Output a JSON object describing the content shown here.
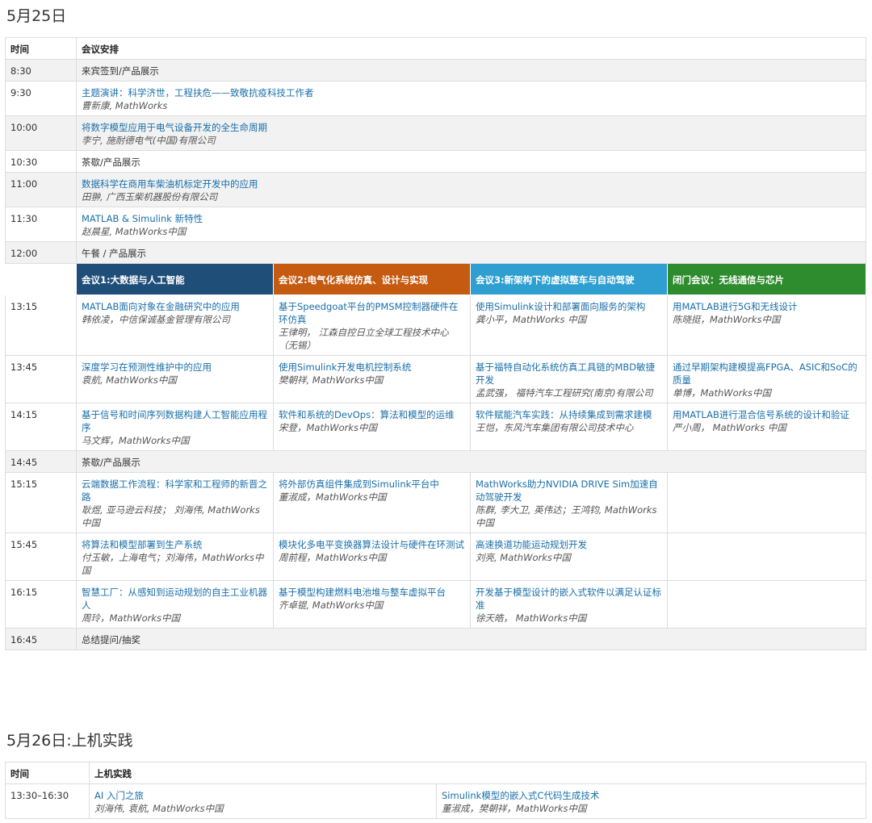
{
  "day1": {
    "heading": "5月25日",
    "header": {
      "time": "时间",
      "agenda": "会议安排"
    },
    "morning": [
      {
        "time": "8:30",
        "type": "plain",
        "text": "来宾签到/产品展示",
        "gray": true
      },
      {
        "time": "9:30",
        "type": "talk",
        "title": "主题演讲：科学济世，工程扶危——致敬抗疫科技工作者",
        "speaker": "曹新康, MathWorks",
        "gray": false
      },
      {
        "time": "10:00",
        "type": "talk",
        "title": "将数字模型应用于电气设备开发的全生命周期",
        "speaker": "李宁, 施耐德电气(中国)有限公司",
        "gray": true
      },
      {
        "time": "10:30",
        "type": "plain",
        "text": "茶歇/产品展示",
        "gray": false
      },
      {
        "time": "11:00",
        "type": "talk",
        "title": "数据科学在商用车柴油机标定开发中的应用",
        "speaker": "田翀, 广西玉柴机器股份有限公司",
        "gray": true
      },
      {
        "time": "11:30",
        "type": "talk",
        "title": "MATLAB & Simulink 新特性",
        "speaker": "赵晨星, MathWorks中国",
        "gray": false
      },
      {
        "time": "12:00",
        "type": "plain",
        "text": "午餐 / 产品展示",
        "gray": true
      }
    ],
    "tracks": [
      {
        "name": "会议1:大数据与人工智能",
        "color": "#1f4e79"
      },
      {
        "name": "会议2:电气化系统仿真、设计与实现",
        "color": "#c55a11"
      },
      {
        "name": "会议3:新架构下的虚拟整车与自动驾驶",
        "color": "#2e9fd0"
      },
      {
        "name": "闭门会议：无线通信与芯片",
        "color": "#2e8b2e"
      }
    ],
    "afternoon": [
      {
        "time": "13:15",
        "sessions": [
          {
            "title": "MATLAB面向对象在金融研究中的应用",
            "speaker": "韩依凌，中信保诚基金管理有限公司"
          },
          {
            "title": "基于Speedgoat平台的PMSM控制器硬件在环仿真",
            "speaker": "王律明， 江森自控日立全球工程技术中心（无锡）"
          },
          {
            "title": "使用Simulink设计和部署面向服务的架构",
            "speaker": "龚小平，MathWorks 中国"
          },
          {
            "title": "用MATLAB进行5G和无线设计",
            "speaker": "陈晓挺，MathWorks中国"
          }
        ]
      },
      {
        "time": "13:45",
        "sessions": [
          {
            "title": "深度学习在预测性维护中的应用",
            "speaker": "袁航, MathWorks中国"
          },
          {
            "title": "使用Simulink开发电机控制系统",
            "speaker": "樊朝祥, MathWorks中国"
          },
          {
            "title": "基于福特自动化系统仿真工具链的MBD敏捷开发",
            "speaker": "孟武强， 福特汽车工程研究(南京)有限公司"
          },
          {
            "title": "通过早期架构建模提高FPGA、ASIC和SoC的质量",
            "speaker": "单博，MathWorks中国"
          }
        ]
      },
      {
        "time": "14:15",
        "sessions": [
          {
            "title": "基于信号和时间序列数据构建人工智能应用程序",
            "speaker": "马文辉，MathWorks中国"
          },
          {
            "title": "软件和系统的DevOps：算法和模型的运维",
            "speaker": "宋登，MathWorks中国"
          },
          {
            "title": "软件赋能汽车实践：从持续集成到需求建模",
            "speaker": "王恺，东风汽车集团有限公司技术中心"
          },
          {
            "title": "用MATLAB进行混合信号系统的设计和验证",
            "speaker": "严小周， MathWorks 中国"
          }
        ]
      },
      {
        "time": "14:45",
        "break": "茶歇/产品展示"
      },
      {
        "time": "15:15",
        "sessions": [
          {
            "title": "云端数据工作流程：科学家和工程师的新晋之路",
            "speaker": "耿煜, 亚马逊云科技； 刘海伟, MathWorks中国"
          },
          {
            "title": "将外部仿真组件集成到Simulink平台中",
            "speaker": "董淑成，MathWorks中国"
          },
          {
            "title": "MathWorks助力NVIDIA DRIVE Sim加速自动驾驶开发",
            "speaker": "陈群, 李大卫, 英伟达；王鸿钧, MathWorks中国"
          },
          {
            "title": "",
            "speaker": ""
          }
        ]
      },
      {
        "time": "15:45",
        "sessions": [
          {
            "title": "将算法和模型部署到生产系统",
            "speaker": "付玉敏，上海电气；刘海伟，MathWorks中国"
          },
          {
            "title": "模块化多电平变换器算法设计与硬件在环测试",
            "speaker": "周前程，MathWorks中国"
          },
          {
            "title": "高速换道功能运动规划开发",
            "speaker": "刘亮, MathWorks中国"
          },
          {
            "title": "",
            "speaker": ""
          }
        ]
      },
      {
        "time": "16:15",
        "sessions": [
          {
            "title": "智慧工厂：从感知到运动规划的自主工业机器人",
            "speaker": "周玲，MathWorks中国"
          },
          {
            "title": "基于模型构建燃料电池堆与整车虚拟平台",
            "speaker": "齐卓锟, MathWorks中国"
          },
          {
            "title": "开发基于模型设计的嵌入式软件以满足认证标准",
            "speaker": "徐天皓， MathWorks中国"
          },
          {
            "title": "",
            "speaker": ""
          }
        ]
      },
      {
        "time": "16:45",
        "break": "总结提问/抽奖"
      }
    ]
  },
  "day2": {
    "heading": "5月26日:上机实践",
    "header": {
      "time": "时间",
      "agenda": "上机实践"
    },
    "rows": [
      {
        "time": "13:30–16:30",
        "sessions": [
          {
            "title": "AI 入门之旅",
            "speaker": "刘海伟, 袁航, MathWorks中国"
          },
          {
            "title": "Simulink模型的嵌入式C代码生成技术",
            "speaker": "董淑成，樊朝祥，MathWorks中国"
          }
        ]
      }
    ]
  }
}
